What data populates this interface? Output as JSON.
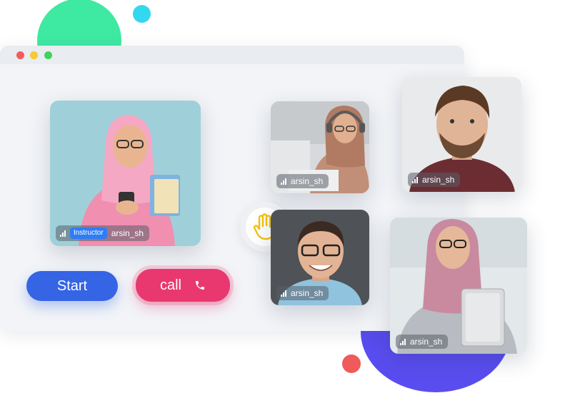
{
  "window": {
    "controls": [
      "close",
      "minimize",
      "maximize"
    ]
  },
  "participants": [
    {
      "role": "Instructor",
      "username": "arsin_sh",
      "icon": "signal-icon"
    },
    {
      "username": "arsin_sh",
      "icon": "signal-icon"
    },
    {
      "username": "arsin_sh",
      "icon": "signal-icon"
    },
    {
      "username": "arsin_sh",
      "icon": "signal-icon"
    },
    {
      "username": "arsin_sh",
      "icon": "signal-icon"
    }
  ],
  "controls": {
    "start_label": "Start",
    "call_label": "call",
    "call_icon": "phone-icon",
    "raise_hand_icon": "hand-icon"
  },
  "colors": {
    "start": "#3564e4",
    "call": "#e8386f",
    "badge": "#2f7df6",
    "hand": "#f4c20d",
    "decor_green": "#3ee9a2",
    "decor_cyan": "#33d8ee",
    "decor_purple": "#5a4df0",
    "decor_red": "#f05a5a"
  }
}
